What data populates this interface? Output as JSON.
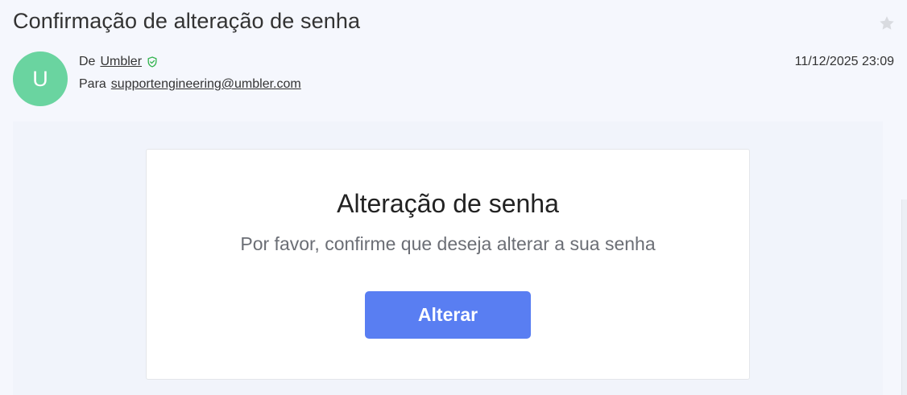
{
  "email": {
    "subject": "Confirmação de alteração de senha",
    "avatar_letter": "U",
    "from_prefix": "De",
    "from_name": "Umbler",
    "to_prefix": "Para",
    "to_address": "supportengineering@umbler.com",
    "date": "11/12/2025 23:09",
    "verified_icon": "shield-check-icon",
    "star_icon": "star-icon",
    "colors": {
      "avatar": "#6ad4a0",
      "verified": "#2fb24c",
      "button": "#597ef2",
      "background": "#f5f7fd"
    }
  },
  "content": {
    "title": "Alteração de senha",
    "subtitle": "Por favor, confirme que deseja alterar a sua senha",
    "button_label": "Alterar"
  }
}
